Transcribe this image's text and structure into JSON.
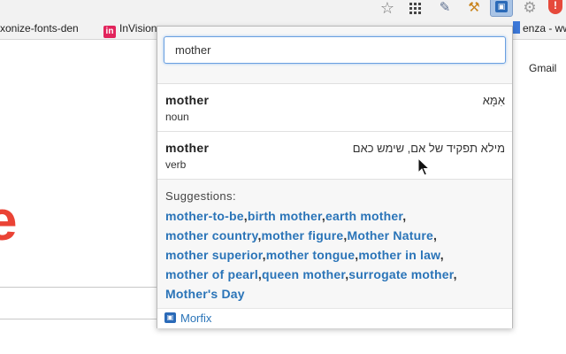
{
  "toolbar": {
    "icons": [
      "star-icon",
      "apps-grid-icon",
      "eyedropper-icon",
      "hammer-icon",
      "morfix-extension-icon",
      "gear-icon",
      "shield-extension-icon"
    ]
  },
  "bookmarks": {
    "items": [
      {
        "label": "xonize-fonts-den",
        "icon": "none"
      },
      {
        "label": "InVision",
        "icon": "invision-icon"
      },
      {
        "label": "enza - www",
        "icon": "bookmark-icon"
      }
    ]
  },
  "page": {
    "gmail_link": "Gmail",
    "logo_fragment": "e"
  },
  "popup": {
    "search": {
      "value": "mother",
      "placeholder": ""
    },
    "results": [
      {
        "word": "mother",
        "part_of_speech": "noun",
        "translation": "אִמָּא"
      },
      {
        "word": "mother",
        "part_of_speech": "verb",
        "translation": "מילא תפקיד של אם, שימש כאם"
      }
    ],
    "suggestions_label": "Suggestions:",
    "suggestions": [
      "mother-to-be",
      "birth mother",
      "earth mother",
      "mother country",
      "mother figure",
      "Mother Nature",
      "mother superior",
      "mother tongue",
      "mother in law",
      "mother of pearl",
      "queen mother",
      "surrogate mother",
      "Mother's Day"
    ],
    "suggestion_lines": [
      [
        0,
        1,
        2
      ],
      [
        3,
        4,
        5
      ],
      [
        6,
        7,
        8
      ],
      [
        9,
        10,
        11
      ],
      [
        12
      ]
    ],
    "footer": {
      "brand": "Morfix"
    }
  },
  "colors": {
    "link": "#2a74b8",
    "focus_border": "#6aa0e0",
    "popup_bg": "#f7f7f7",
    "google_red": "#ea4335"
  }
}
